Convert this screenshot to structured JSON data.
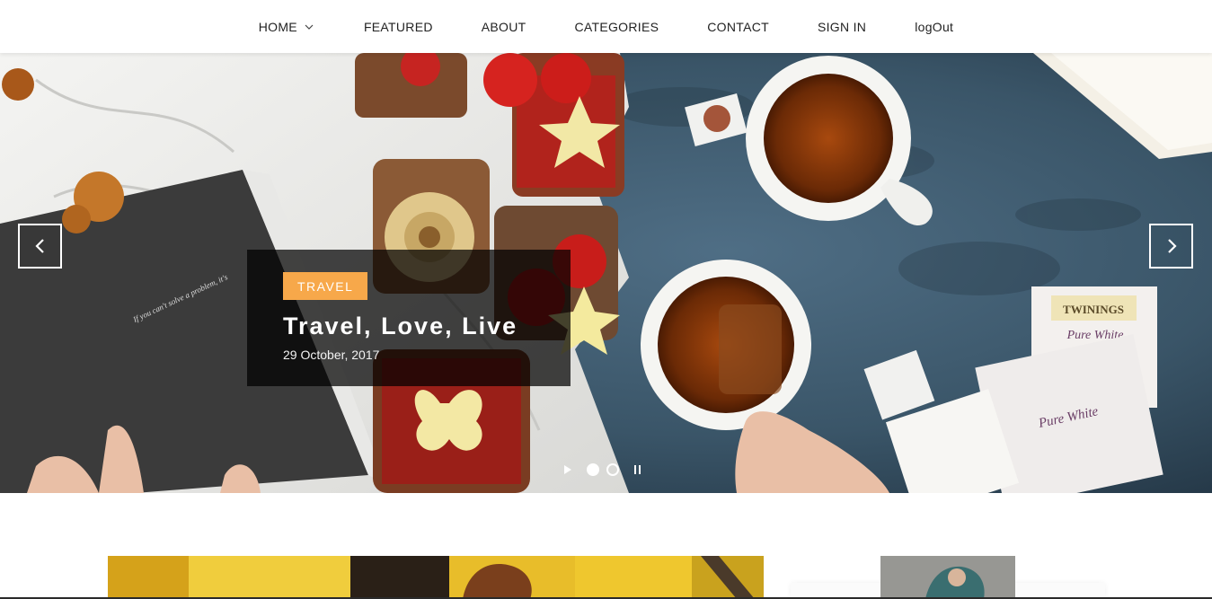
{
  "nav": {
    "items": [
      {
        "label": "HOME",
        "has_dropdown": true
      },
      {
        "label": "FEATURED"
      },
      {
        "label": "ABOUT"
      },
      {
        "label": "CATEGORIES"
      },
      {
        "label": "CONTACT"
      },
      {
        "label": "SIGN IN"
      },
      {
        "label": "logOut"
      }
    ]
  },
  "hero": {
    "slide": {
      "category": "TRAVEL",
      "title": "Travel, Love, Live",
      "date": "29 October, 2017"
    },
    "prev_icon": "chevron-left-icon",
    "next_icon": "chevron-right-icon",
    "slide_count": 2,
    "active_slide": 1
  },
  "colors": {
    "accent": "#f7a84a",
    "caption_bg": "rgba(0,0,0,0.72)",
    "nav_text": "#222222"
  }
}
